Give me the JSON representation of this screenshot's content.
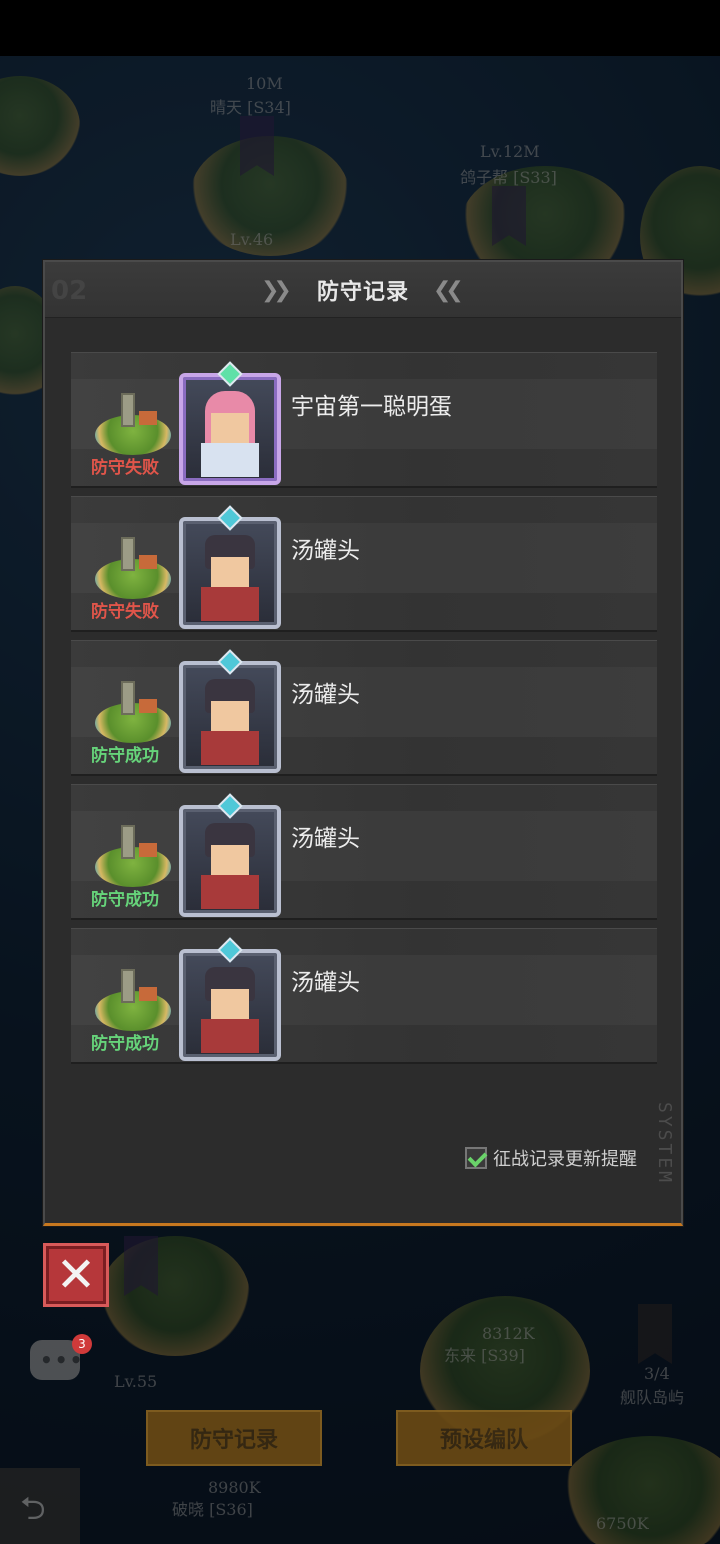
{
  "dialog": {
    "title": "防守记录",
    "header_deco": "02",
    "remind_label": "征战记录更新提醒",
    "remind_checked": true,
    "system_tag": "SYSTEM"
  },
  "records": [
    {
      "result": "防守失败",
      "status": "fail",
      "player": "宇宙第一聪明蛋",
      "avatar": "pink-haired-girl-portrait"
    },
    {
      "result": "防守失败",
      "status": "fail",
      "player": "汤罐头",
      "avatar": "capped-boy-portrait"
    },
    {
      "result": "防守成功",
      "status": "win",
      "player": "汤罐头",
      "avatar": "capped-boy-portrait"
    },
    {
      "result": "防守成功",
      "status": "win",
      "player": "汤罐头",
      "avatar": "capped-boy-portrait"
    },
    {
      "result": "防守成功",
      "status": "win",
      "player": "汤罐头",
      "avatar": "capped-boy-portrait"
    }
  ],
  "map_labels": [
    {
      "text": "10M"
    },
    {
      "text": "晴天 [S34]"
    },
    {
      "text": "Lv.12M"
    },
    {
      "text": "鸽子帮 [S33]"
    },
    {
      "text": "Lv.46"
    },
    {
      "text": "Lv.55"
    },
    {
      "text": "8312K"
    },
    {
      "text": "东来 [S39]"
    },
    {
      "text": "3/4"
    },
    {
      "text": "舰队岛屿"
    },
    {
      "text": "8980K"
    },
    {
      "text": "破晓 [S36]"
    },
    {
      "text": "6750K"
    }
  ],
  "buttons": {
    "close": "✕",
    "defense_record": "防守记录",
    "preset_team": "预设编队",
    "back": "⮌"
  },
  "chat": {
    "badge": "3"
  },
  "colors": {
    "fail": "#e0554a",
    "win": "#66d37a",
    "accent": "#c7781f",
    "close": "#b6373a"
  }
}
